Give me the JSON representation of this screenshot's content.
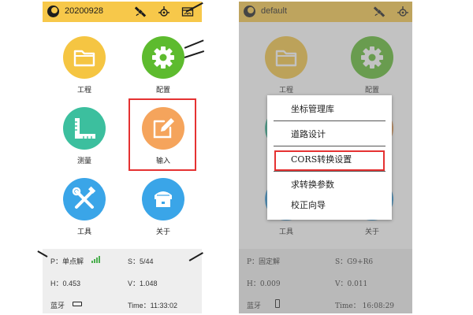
{
  "left_screen": {
    "project_name": "20200928",
    "tiles": [
      {
        "label": "工程",
        "icon": "folder-icon",
        "color": "#f5c542"
      },
      {
        "label": "配置",
        "icon": "gear-icon",
        "color": "#5dbb2e"
      },
      {
        "label": "测量",
        "icon": "ruler-icon",
        "color": "#3cbf9e"
      },
      {
        "label": "输入",
        "icon": "edit-icon",
        "color": "#f5a45c"
      },
      {
        "label": "工具",
        "icon": "tools-icon",
        "color": "#3aa5e8"
      },
      {
        "label": "关于",
        "icon": "receiver-icon",
        "color": "#3aa5e8"
      }
    ],
    "status": {
      "position": "P：单点解",
      "satellites": "S：5/44",
      "h": "H：0.453",
      "v": "V：1.048",
      "bluetooth": "蓝牙",
      "time": "Time：11:33:02"
    }
  },
  "right_screen": {
    "project_name": "default",
    "tiles": [
      {
        "label": "工程"
      },
      {
        "label": "配置"
      },
      {
        "label": "工具"
      },
      {
        "label": "关于"
      }
    ],
    "menu": {
      "items": [
        {
          "label": "坐标管理库"
        },
        {
          "label": "道路设计"
        },
        {
          "label": "CORS转换设置"
        },
        {
          "label": "求转换参数"
        },
        {
          "label": "校正向导"
        }
      ]
    },
    "status": {
      "position": "P：固定解",
      "satellites": "S：G9+R6",
      "h": "H：0.009",
      "v": "V：0.011",
      "bluetooth": "蓝牙",
      "time": "Time： 16:08:29"
    }
  },
  "colors": {
    "topbar": "#f7c84a",
    "highlight": "#e53232",
    "status_bg": "#eeeeee"
  }
}
